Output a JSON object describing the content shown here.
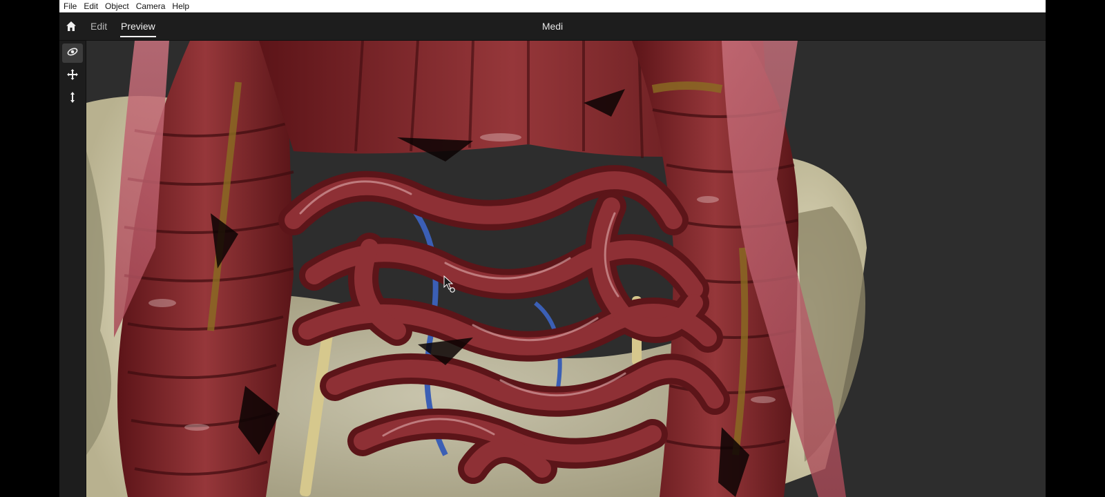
{
  "menu": {
    "items": [
      "File",
      "Edit",
      "Object",
      "Camera",
      "Help"
    ]
  },
  "toolbar": {
    "edit_tab": "Edit",
    "preview_tab": "Preview",
    "document_title": "Medi"
  },
  "side_tools": [
    {
      "icon": "orbit-icon",
      "active": true
    },
    {
      "icon": "pan-icon",
      "active": false
    },
    {
      "icon": "zoom-icon",
      "active": false
    }
  ],
  "viewport": {
    "scene": "3d-anatomy-abdomen",
    "cursor": "rotate-cursor-icon"
  },
  "colors": {
    "menubar_bg": "#ffffff",
    "toolbar_bg": "#1d1d1d",
    "viewport_bg": "#2d2d2d",
    "organ_red": "#7a2327",
    "bone": "#d7d1b2"
  }
}
